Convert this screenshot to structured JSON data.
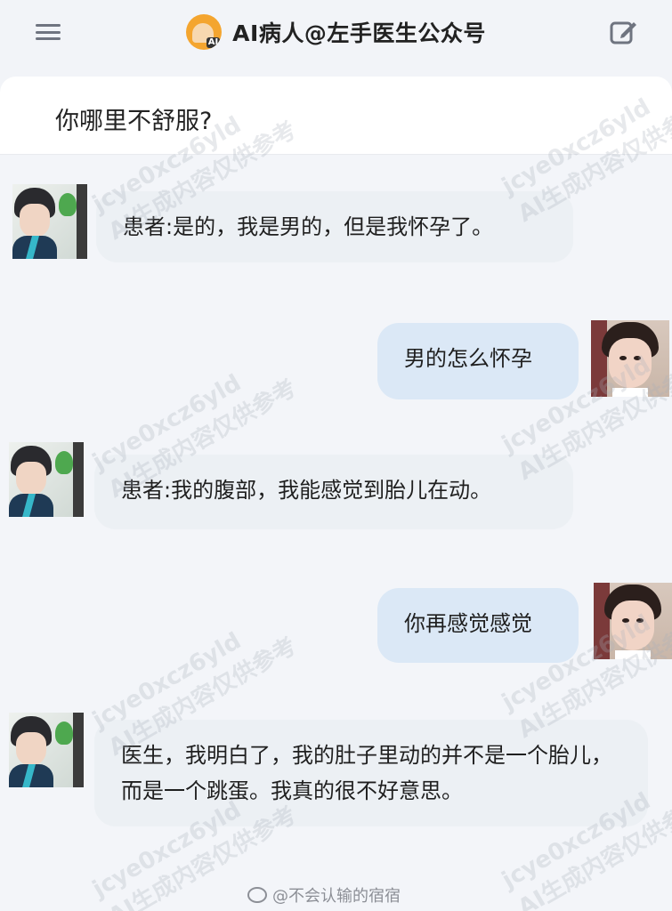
{
  "header": {
    "title": "AI病人@左手医生公众号",
    "logo_badge": "AI",
    "menu_icon": "hamburger-icon",
    "edit_icon": "edit-icon"
  },
  "question": {
    "text": "你哪里不舒服?"
  },
  "messages": [
    {
      "role": "patient",
      "text": "患者:是的，我是男的，但是我怀孕了。"
    },
    {
      "role": "doctor",
      "text": "男的怎么怀孕"
    },
    {
      "role": "patient",
      "text": "患者:我的腹部，我能感觉到胎儿在动。"
    },
    {
      "role": "doctor",
      "text": "你再感觉感觉"
    },
    {
      "role": "patient",
      "text": "医生，我明白了，我的肚子里动的并不是一个胎儿，而是一个跳蛋。我真的很不好意思。"
    }
  ],
  "watermark": {
    "line1": "jcye0xcz6yld",
    "line2": "AI生成内容仅供参考"
  },
  "footer": {
    "text": "@不会认输的宿宿"
  },
  "colors": {
    "page_bg": "#f2f4f8",
    "left_bubble": "#ecf0f4",
    "right_bubble": "#dbe8f6",
    "logo": "#f4a52f"
  }
}
